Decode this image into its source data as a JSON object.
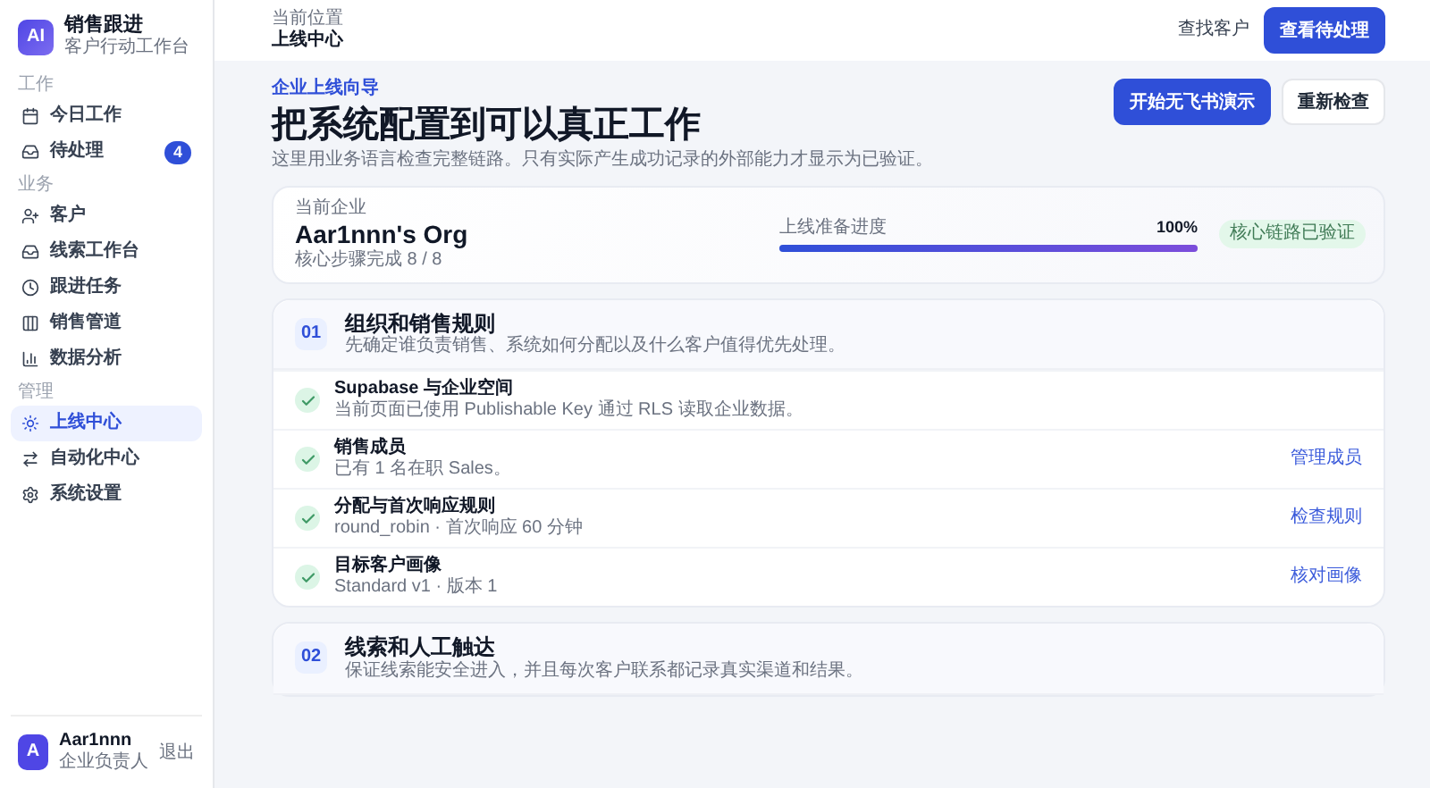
{
  "brand": {
    "logo": "AI",
    "name": "销售跟进",
    "subtitle": "客户行动工作台"
  },
  "sidebar": {
    "groups": [
      {
        "label": "工作",
        "items": [
          {
            "label": "今日工作",
            "selected": false
          },
          {
            "label": "待处理",
            "selected": false,
            "badge": "4"
          }
        ]
      },
      {
        "label": "业务",
        "items": [
          {
            "label": "客户",
            "selected": false
          },
          {
            "label": "线索工作台",
            "selected": false
          },
          {
            "label": "跟进任务",
            "selected": false
          },
          {
            "label": "销售管道",
            "selected": false
          },
          {
            "label": "数据分析",
            "selected": false
          }
        ]
      },
      {
        "label": "管理",
        "items": [
          {
            "label": "上线中心",
            "selected": true
          },
          {
            "label": "自动化中心",
            "selected": false
          },
          {
            "label": "系统设置",
            "selected": false
          }
        ]
      }
    ]
  },
  "user": {
    "initial": "A",
    "name": "Aar1nnn",
    "role": "企业负责人",
    "logout": "退出"
  },
  "topbar": {
    "caption": "当前位置",
    "title": "上线中心",
    "link": "查找客户",
    "button": "查看待处理"
  },
  "hero": {
    "eyebrow": "企业上线向导",
    "title": "把系统配置到可以真正工作",
    "description": "这里用业务语言检查完整链路。只有实际产生成功记录的外部能力才显示为已验证。",
    "buttons": [
      {
        "label": "开始无飞书演示",
        "primary": true
      },
      {
        "label": "重新检查",
        "primary": false
      }
    ]
  },
  "org": {
    "caption": "当前企业",
    "name": "Aar1nnn's Org",
    "summary": "核心步骤完成 8 / 8",
    "progress_label": "上线准备进度",
    "level": 1,
    "reading": "100%",
    "status": "核心链路已验证"
  },
  "sections": [
    {
      "number": "01",
      "title": "组织和销售规则",
      "description": "先确定谁负责销售、系统如何分配以及什么客户值得优先处理。",
      "steps": [
        {
          "title": "Supabase 与企业空间",
          "detail": "当前页面已使用 Publishable Key 通过 RLS 读取企业数据。",
          "done": true
        },
        {
          "title": "销售成员",
          "detail": "已有 1 名在职 Sales。",
          "done": true,
          "action": "管理成员"
        },
        {
          "title": "分配与首次响应规则",
          "detail": "round_robin · 首次响应 60 分钟",
          "done": true,
          "action": "检查规则"
        },
        {
          "title": "目标客户画像",
          "detail": "Standard v1 · 版本 1",
          "done": true,
          "action": "核对画像"
        }
      ]
    },
    {
      "number": "02",
      "title": "线索和人工触达",
      "description": "保证线索能安全进入，并且每次客户联系都记录真实渠道和结果。"
    }
  ]
}
